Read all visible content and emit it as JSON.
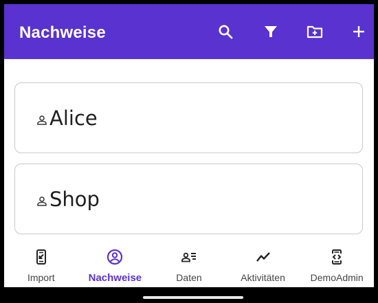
{
  "appbar": {
    "title": "Nachweise",
    "background": "#5a32cf",
    "actions": [
      "search-icon",
      "filter-icon",
      "add-folder-icon",
      "add-icon"
    ]
  },
  "cards": [
    {
      "label": "Alice",
      "icon": "person-icon"
    },
    {
      "label": "Shop",
      "icon": "person-icon"
    }
  ],
  "bottom_nav": {
    "items": [
      {
        "label": "Import",
        "icon": "import-phone-icon",
        "active": false
      },
      {
        "label": "Nachweise",
        "icon": "account-circle-icon",
        "active": true
      },
      {
        "label": "Daten",
        "icon": "person-list-icon",
        "active": false
      },
      {
        "label": "Aktivitäten",
        "icon": "activity-line-icon",
        "active": false
      },
      {
        "label": "DemoAdmin",
        "icon": "developer-mode-icon",
        "active": false
      }
    ],
    "active_color": "#5a32cf"
  }
}
